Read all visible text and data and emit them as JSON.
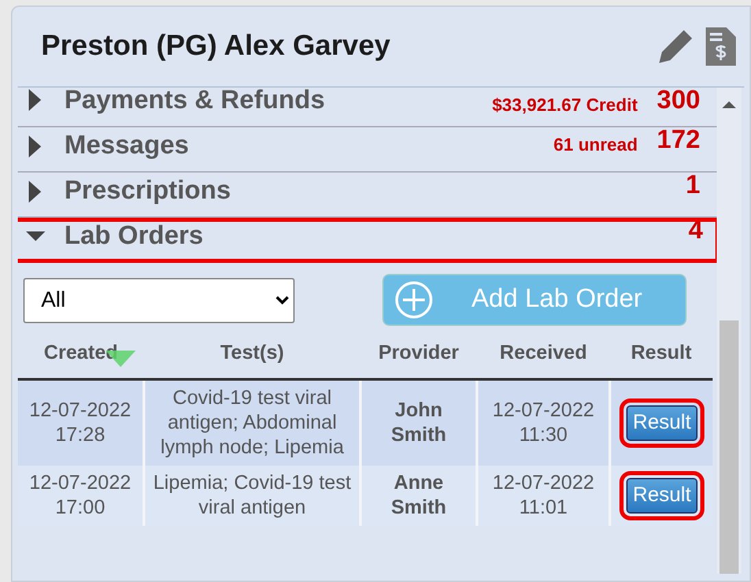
{
  "title": "Preston (PG) Alex Garvey",
  "sections": [
    {
      "label": "Payments & Refunds",
      "note": "$33,921.67 Credit",
      "count": "300",
      "expanded": false,
      "highlighted": false
    },
    {
      "label": "Messages",
      "note": "61 unread",
      "count": "172",
      "expanded": false,
      "highlighted": false
    },
    {
      "label": "Prescriptions",
      "count": "1",
      "expanded": false,
      "highlighted": false
    },
    {
      "label": "Lab Orders",
      "count": "4",
      "expanded": true,
      "highlighted": true
    }
  ],
  "lab_orders": {
    "filter": {
      "value": "All"
    },
    "add_button": "Add Lab Order",
    "columns": [
      {
        "label": "Created",
        "sorted": true
      },
      {
        "label": "Test(s)",
        "sorted": false
      },
      {
        "label": "Provider",
        "sorted": false
      },
      {
        "label": "Received",
        "sorted": false
      },
      {
        "label": "Result",
        "sorted": false
      }
    ],
    "rows": [
      {
        "created": "12-07-2022 17:28",
        "tests": "Covid-19 test viral antigen; Abdominal lymph node; Lipemia",
        "provider": "John Smith",
        "received": "12-07-2022 11:30",
        "result": "Result",
        "selected": true,
        "highlighted": true
      },
      {
        "created": "12-07-2022 17:00",
        "tests": "Lipemia; Covid-19 test viral antigen",
        "provider": "Anne Smith",
        "received": "12-07-2022 11:01",
        "result": "Result",
        "selected": false,
        "highlighted": true
      }
    ]
  }
}
